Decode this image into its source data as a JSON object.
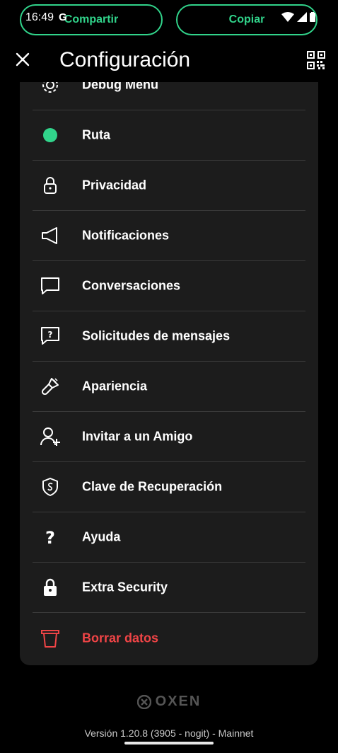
{
  "status_bar": {
    "time": "16:49",
    "g_icons": "G",
    "share_label": "Compartir",
    "copy_label": "Copiar"
  },
  "header": {
    "title": "Configuración"
  },
  "menu": {
    "items": [
      {
        "label": "Debug Menu",
        "icon": "gear-icon"
      },
      {
        "label": "Ruta",
        "icon": "green-dot-icon"
      },
      {
        "label": "Privacidad",
        "icon": "lock-icon"
      },
      {
        "label": "Notificaciones",
        "icon": "megaphone-icon"
      },
      {
        "label": "Conversaciones",
        "icon": "chat-bubble-icon"
      },
      {
        "label": "Solicitudes de mensajes",
        "icon": "chat-question-icon"
      },
      {
        "label": "Apariencia",
        "icon": "paintbrush-icon"
      },
      {
        "label": "Invitar a un Amigo",
        "icon": "add-user-icon"
      },
      {
        "label": "Clave de Recuperación",
        "icon": "shield-icon"
      },
      {
        "label": "Ayuda",
        "icon": "question-icon"
      },
      {
        "label": "Extra Security",
        "icon": "lock-filled-icon"
      },
      {
        "label": "Borrar datos",
        "icon": "trash-icon"
      }
    ]
  },
  "footer": {
    "brand": "OXEN",
    "version": "Versión  1.20.8 (3905 - nogit)  - Mainnet"
  },
  "colors": {
    "accent": "#31d48b",
    "danger": "#ef4446",
    "card_bg": "#1c1c1c"
  }
}
